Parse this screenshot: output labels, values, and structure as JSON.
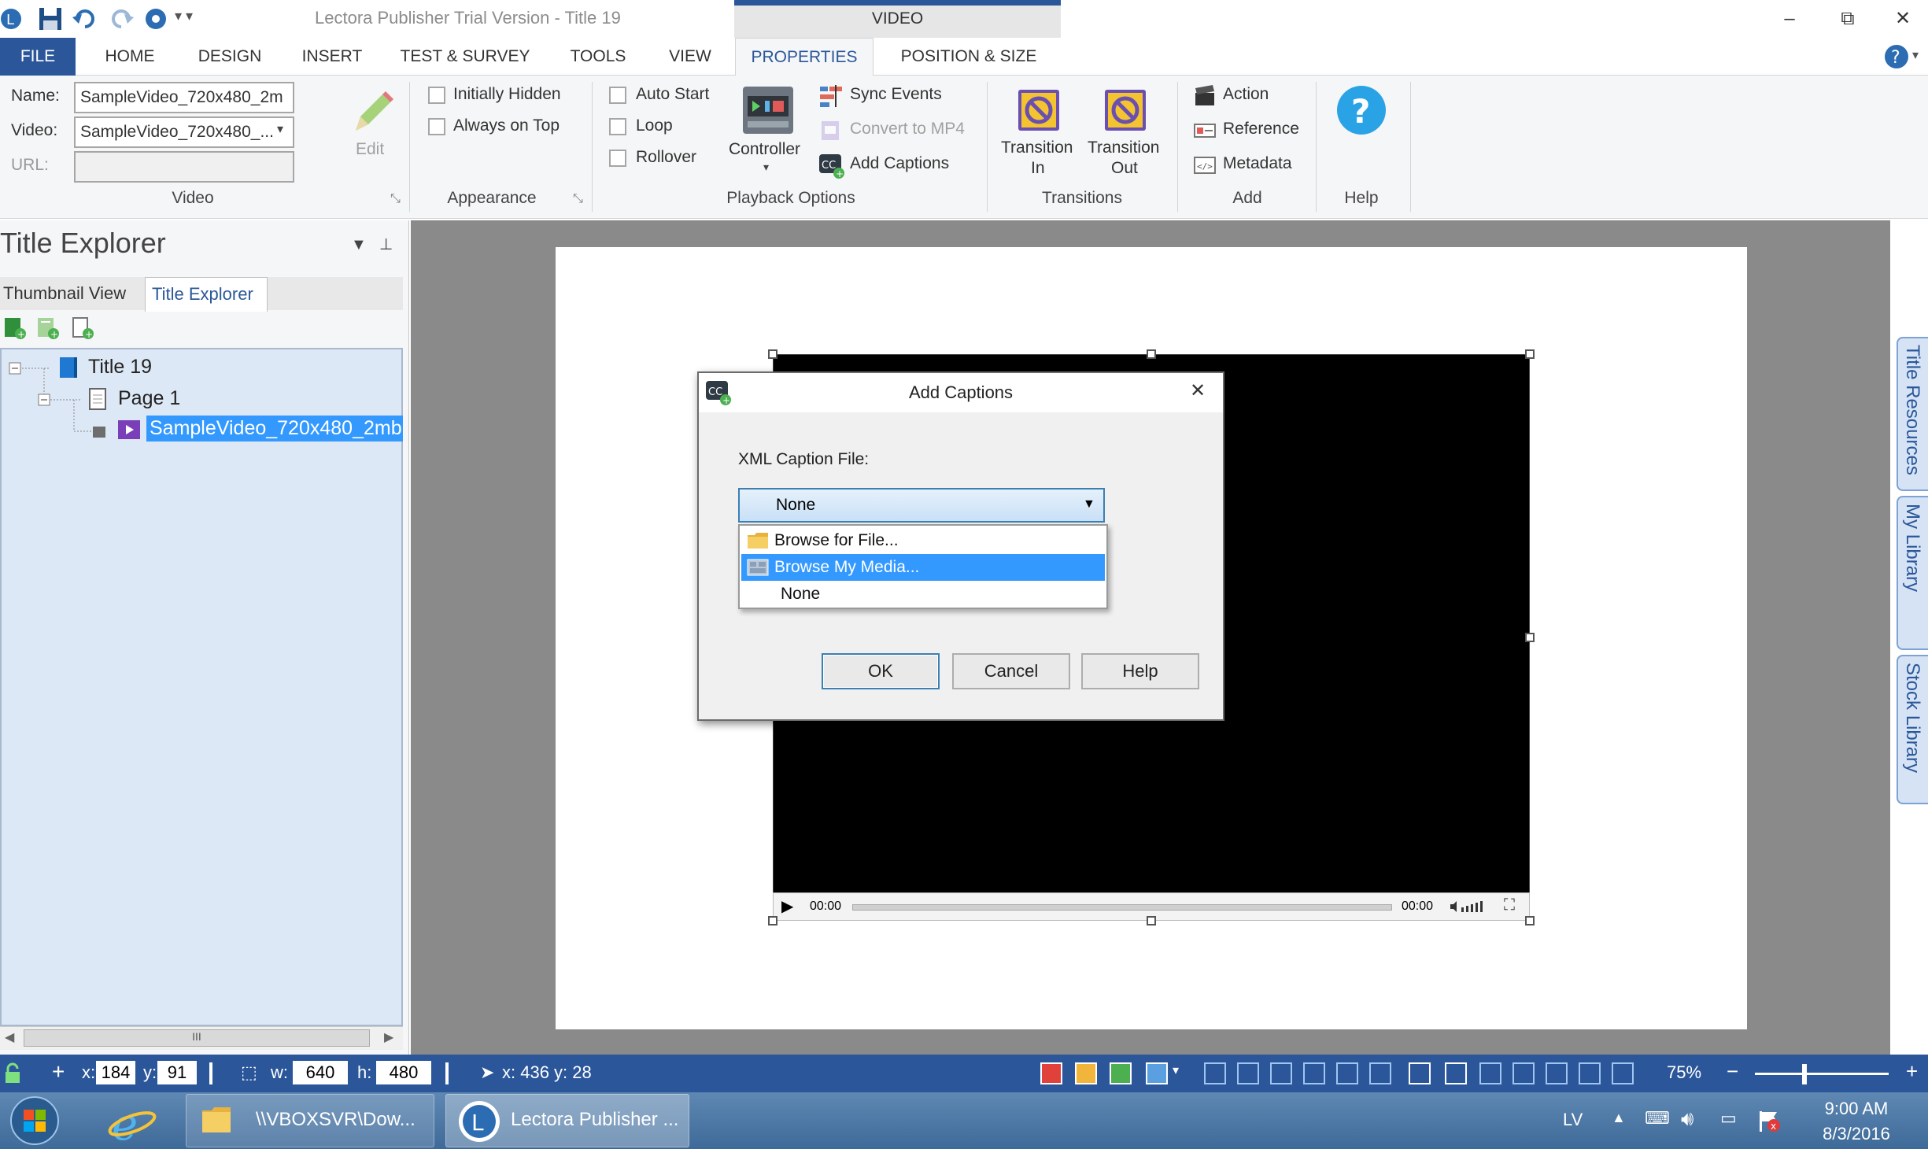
{
  "window": {
    "title": "Lectora Publisher Trial Version - Title 19",
    "context_tab_group": "VIDEO",
    "controls": {
      "minimize": "–",
      "restore": "⧉",
      "close": "✕"
    }
  },
  "quick_access": [
    "app-logo-icon",
    "save-icon",
    "undo-icon",
    "redo-icon",
    "settings-gear-icon",
    "customize-dropdown-icon"
  ],
  "ribbon_tabs": [
    "FILE",
    "HOME",
    "DESIGN",
    "INSERT",
    "TEST & SURVEY",
    "TOOLS",
    "VIEW",
    "PROPERTIES",
    "POSITION & SIZE"
  ],
  "ribbon": {
    "video_group": {
      "name_label": "Name:",
      "name_value": "SampleVideo_720x480_2m",
      "video_label": "Video:",
      "video_value": "SampleVideo_720x480_...",
      "url_label": "URL:",
      "url_value": "",
      "edit_label": "Edit",
      "group_label": "Video"
    },
    "appearance_group": {
      "initially_hidden": "Initially Hidden",
      "always_on_top": "Always on Top",
      "group_label": "Appearance"
    },
    "playback_group": {
      "auto_start": "Auto Start",
      "loop": "Loop",
      "rollover": "Rollover",
      "controller": "Controller",
      "sync_events": "Sync Events",
      "convert_to_mp4": "Convert to MP4",
      "add_captions": "Add Captions",
      "group_label": "Playback Options"
    },
    "transitions_group": {
      "transition_in_1": "Transition",
      "transition_in_2": "In",
      "transition_out_1": "Transition",
      "transition_out_2": "Out",
      "group_label": "Transitions"
    },
    "add_group": {
      "action": "Action",
      "reference": "Reference",
      "metadata": "Metadata",
      "group_label": "Add"
    },
    "help_group": {
      "group_label": "Help"
    }
  },
  "left_panel": {
    "title": "Title Explorer",
    "tabs": [
      "Thumbnail View",
      "Title Explorer"
    ],
    "tree": {
      "title": "Title 19",
      "page": "Page 1",
      "video": "SampleVideo_720x480_2mb"
    },
    "scroll_thumb": "III"
  },
  "video_player": {
    "time_start": "00:00",
    "time_end": "00:00"
  },
  "side_tabs": [
    "Title Resources",
    "My Library",
    "Stock Library"
  ],
  "dialog": {
    "title": "Add Captions",
    "close": "✕",
    "field_label": "XML Caption File:",
    "selected": "None",
    "options": [
      "Browse for File...",
      "Browse My Media...",
      "None"
    ],
    "highlighted_option_index": 1,
    "buttons": {
      "ok": "OK",
      "cancel": "Cancel",
      "help": "Help"
    }
  },
  "status_bar": {
    "x_label": "x:",
    "x_value": "184",
    "y_label": "y:",
    "y_value": "91",
    "w_label": "w:",
    "w_value": "640",
    "h_label": "h:",
    "h_value": "480",
    "cursor": "x: 436  y: 28",
    "zoom": "75%",
    "zoom_minus": "−",
    "zoom_plus": "+"
  },
  "taskbar": {
    "items": [
      "\\\\VBOXSVR\\Dow...",
      "Lectora Publisher ..."
    ],
    "language": "LV",
    "time": "9:00 AM",
    "date": "8/3/2016"
  },
  "colors": {
    "accent": "#2b579a",
    "selection": "#3399ff",
    "ribbon_bg": "#f5f6f7"
  }
}
